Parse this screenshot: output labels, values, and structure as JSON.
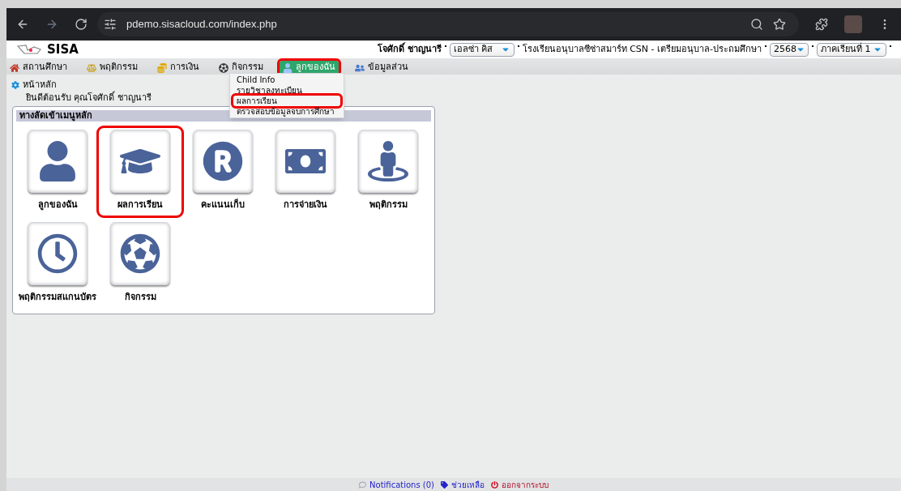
{
  "browser": {
    "url": "pdemo.sisacloud.com/index.php"
  },
  "header": {
    "logo_text": "SISA",
    "user_name": "โจศักดิ์ ชาญนารี",
    "child_select": "เอลซ่า คิส",
    "school": "โรงเรียนอนุบาลซีซ่าสมาร์ท CSN - เตรียมอนุบาล-ประถมศึกษา",
    "year_select": "2568",
    "term_select": "ภาคเรียนที่ 1"
  },
  "nav": [
    {
      "label": "สถานศึกษา",
      "selected": false,
      "highlighted": false
    },
    {
      "label": "พฤติกรรม",
      "selected": false,
      "highlighted": false
    },
    {
      "label": "การเงิน",
      "selected": false,
      "highlighted": false
    },
    {
      "label": "กิจกรรม",
      "selected": false,
      "highlighted": false
    },
    {
      "label": "ลูกของฉัน",
      "selected": true,
      "highlighted": true
    },
    {
      "label": "ข้อมูลส่วน",
      "selected": false,
      "highlighted": false
    }
  ],
  "dropdown": [
    {
      "label": "Child Info",
      "highlighted": false
    },
    {
      "label": "รายวิชาลงทะเบียน",
      "highlighted": false
    },
    {
      "label": "ผลการเรียน",
      "highlighted": true
    },
    {
      "label": "ตรวจสอบข้อมูลจบการศึกษา",
      "highlighted": false
    }
  ],
  "breadcrumb": "หน้าหลัก",
  "welcome": "ยินดีต้อนรับ คุณโจศักดิ์ ชาญนารี",
  "panel": {
    "title": "ทางลัดเข้าเมนูหลัก",
    "shortcuts": [
      {
        "label": "ลูกของฉัน",
        "highlighted": false
      },
      {
        "label": "ผลการเรียน",
        "highlighted": true
      },
      {
        "label": "คะแนนเก็บ",
        "highlighted": false
      },
      {
        "label": "การจ่ายเงิน",
        "highlighted": false
      },
      {
        "label": "พฤติกรรม",
        "highlighted": false
      },
      {
        "label": "พฤติกรรมสแกนบัตร",
        "highlighted": false
      },
      {
        "label": "กิจกรรม",
        "highlighted": false
      }
    ]
  },
  "footer": [
    {
      "label": "Notifications (0)",
      "kind": "link"
    },
    {
      "label": "ช่วยเหลือ",
      "kind": "link"
    },
    {
      "label": "ออกจากระบบ",
      "kind": "logout"
    }
  ]
}
